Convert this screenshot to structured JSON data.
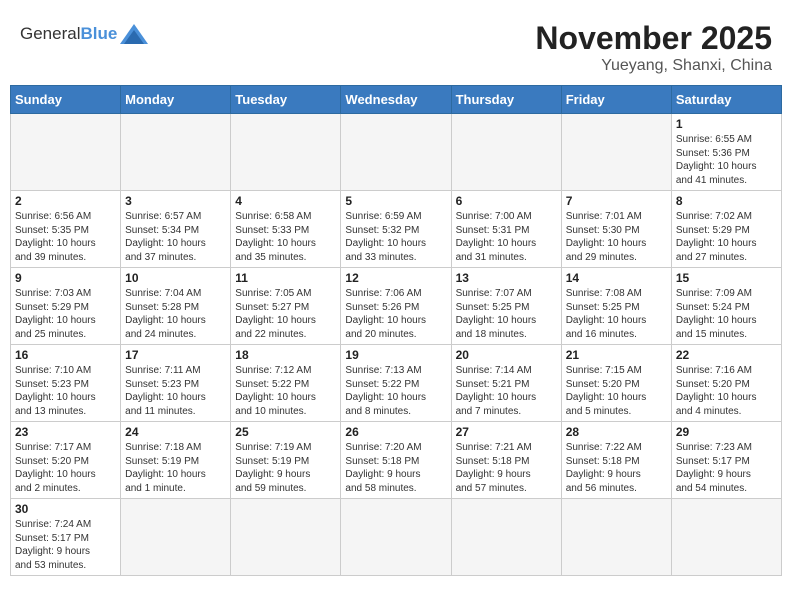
{
  "header": {
    "logo_general": "General",
    "logo_blue": "Blue",
    "month_title": "November 2025",
    "location": "Yueyang, Shanxi, China"
  },
  "weekdays": [
    "Sunday",
    "Monday",
    "Tuesday",
    "Wednesday",
    "Thursday",
    "Friday",
    "Saturday"
  ],
  "weeks": [
    [
      {
        "day": "",
        "info": ""
      },
      {
        "day": "",
        "info": ""
      },
      {
        "day": "",
        "info": ""
      },
      {
        "day": "",
        "info": ""
      },
      {
        "day": "",
        "info": ""
      },
      {
        "day": "",
        "info": ""
      },
      {
        "day": "1",
        "info": "Sunrise: 6:55 AM\nSunset: 5:36 PM\nDaylight: 10 hours\nand 41 minutes."
      }
    ],
    [
      {
        "day": "2",
        "info": "Sunrise: 6:56 AM\nSunset: 5:35 PM\nDaylight: 10 hours\nand 39 minutes."
      },
      {
        "day": "3",
        "info": "Sunrise: 6:57 AM\nSunset: 5:34 PM\nDaylight: 10 hours\nand 37 minutes."
      },
      {
        "day": "4",
        "info": "Sunrise: 6:58 AM\nSunset: 5:33 PM\nDaylight: 10 hours\nand 35 minutes."
      },
      {
        "day": "5",
        "info": "Sunrise: 6:59 AM\nSunset: 5:32 PM\nDaylight: 10 hours\nand 33 minutes."
      },
      {
        "day": "6",
        "info": "Sunrise: 7:00 AM\nSunset: 5:31 PM\nDaylight: 10 hours\nand 31 minutes."
      },
      {
        "day": "7",
        "info": "Sunrise: 7:01 AM\nSunset: 5:30 PM\nDaylight: 10 hours\nand 29 minutes."
      },
      {
        "day": "8",
        "info": "Sunrise: 7:02 AM\nSunset: 5:29 PM\nDaylight: 10 hours\nand 27 minutes."
      }
    ],
    [
      {
        "day": "9",
        "info": "Sunrise: 7:03 AM\nSunset: 5:29 PM\nDaylight: 10 hours\nand 25 minutes."
      },
      {
        "day": "10",
        "info": "Sunrise: 7:04 AM\nSunset: 5:28 PM\nDaylight: 10 hours\nand 24 minutes."
      },
      {
        "day": "11",
        "info": "Sunrise: 7:05 AM\nSunset: 5:27 PM\nDaylight: 10 hours\nand 22 minutes."
      },
      {
        "day": "12",
        "info": "Sunrise: 7:06 AM\nSunset: 5:26 PM\nDaylight: 10 hours\nand 20 minutes."
      },
      {
        "day": "13",
        "info": "Sunrise: 7:07 AM\nSunset: 5:25 PM\nDaylight: 10 hours\nand 18 minutes."
      },
      {
        "day": "14",
        "info": "Sunrise: 7:08 AM\nSunset: 5:25 PM\nDaylight: 10 hours\nand 16 minutes."
      },
      {
        "day": "15",
        "info": "Sunrise: 7:09 AM\nSunset: 5:24 PM\nDaylight: 10 hours\nand 15 minutes."
      }
    ],
    [
      {
        "day": "16",
        "info": "Sunrise: 7:10 AM\nSunset: 5:23 PM\nDaylight: 10 hours\nand 13 minutes."
      },
      {
        "day": "17",
        "info": "Sunrise: 7:11 AM\nSunset: 5:23 PM\nDaylight: 10 hours\nand 11 minutes."
      },
      {
        "day": "18",
        "info": "Sunrise: 7:12 AM\nSunset: 5:22 PM\nDaylight: 10 hours\nand 10 minutes."
      },
      {
        "day": "19",
        "info": "Sunrise: 7:13 AM\nSunset: 5:22 PM\nDaylight: 10 hours\nand 8 minutes."
      },
      {
        "day": "20",
        "info": "Sunrise: 7:14 AM\nSunset: 5:21 PM\nDaylight: 10 hours\nand 7 minutes."
      },
      {
        "day": "21",
        "info": "Sunrise: 7:15 AM\nSunset: 5:20 PM\nDaylight: 10 hours\nand 5 minutes."
      },
      {
        "day": "22",
        "info": "Sunrise: 7:16 AM\nSunset: 5:20 PM\nDaylight: 10 hours\nand 4 minutes."
      }
    ],
    [
      {
        "day": "23",
        "info": "Sunrise: 7:17 AM\nSunset: 5:20 PM\nDaylight: 10 hours\nand 2 minutes."
      },
      {
        "day": "24",
        "info": "Sunrise: 7:18 AM\nSunset: 5:19 PM\nDaylight: 10 hours\nand 1 minute."
      },
      {
        "day": "25",
        "info": "Sunrise: 7:19 AM\nSunset: 5:19 PM\nDaylight: 9 hours\nand 59 minutes."
      },
      {
        "day": "26",
        "info": "Sunrise: 7:20 AM\nSunset: 5:18 PM\nDaylight: 9 hours\nand 58 minutes."
      },
      {
        "day": "27",
        "info": "Sunrise: 7:21 AM\nSunset: 5:18 PM\nDaylight: 9 hours\nand 57 minutes."
      },
      {
        "day": "28",
        "info": "Sunrise: 7:22 AM\nSunset: 5:18 PM\nDaylight: 9 hours\nand 56 minutes."
      },
      {
        "day": "29",
        "info": "Sunrise: 7:23 AM\nSunset: 5:17 PM\nDaylight: 9 hours\nand 54 minutes."
      }
    ],
    [
      {
        "day": "30",
        "info": "Sunrise: 7:24 AM\nSunset: 5:17 PM\nDaylight: 9 hours\nand 53 minutes."
      },
      {
        "day": "",
        "info": ""
      },
      {
        "day": "",
        "info": ""
      },
      {
        "day": "",
        "info": ""
      },
      {
        "day": "",
        "info": ""
      },
      {
        "day": "",
        "info": ""
      },
      {
        "day": "",
        "info": ""
      }
    ]
  ]
}
